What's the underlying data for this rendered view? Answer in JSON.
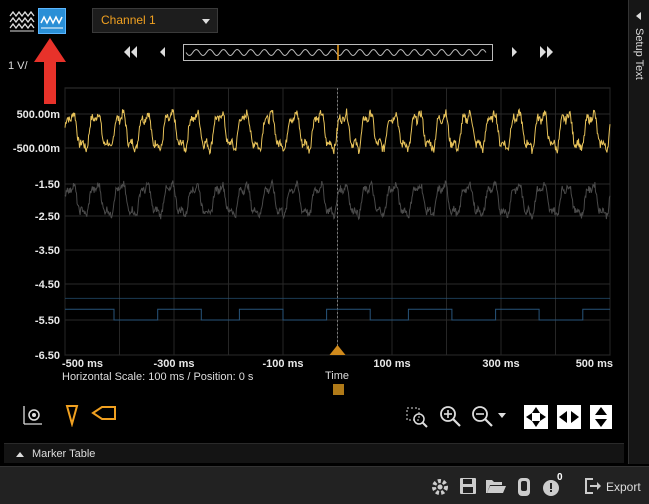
{
  "toolbar": {
    "overlay_icon": "waveform-overlay-icon",
    "single_icon": "waveform-single-icon",
    "channel_selected": "Channel 1"
  },
  "side_panel": {
    "label": "Setup Text"
  },
  "vertical_scale": "1 V/",
  "chart_data": {
    "type": "line",
    "y_ticks": [
      "500.00m",
      "-500.00m",
      "-1.50",
      "-2.50",
      "-3.50",
      "-4.50",
      "-5.50",
      "-6.50"
    ],
    "x_ticks": [
      "-500 ms",
      "-300 ms",
      "-100 ms",
      "100 ms",
      "300 ms",
      "500 ms"
    ],
    "xlim": [
      -500,
      500
    ],
    "xlabel": "Time",
    "grid": true,
    "series": [
      {
        "color": "#e8c35a",
        "shape": "noisy-sine",
        "center": 0.0,
        "amplitude": 0.5
      },
      {
        "color": "#4a4a4a",
        "shape": "noisy-sine",
        "center": -2.0,
        "amplitude": 0.45
      },
      {
        "color": "#27547a",
        "shape": "digital",
        "levels": [
          -5.2,
          -5.5
        ]
      }
    ]
  },
  "horizontal": {
    "scale_text": "Horizontal Scale: 100 ms /  Position: 0 s",
    "time_label": "Time"
  },
  "marker_table": {
    "label": "Marker Table"
  },
  "footer": {
    "export_label": "Export",
    "badge_count": "0"
  },
  "colors": {
    "accent": "#f0a020",
    "selected": "#2a8fd6",
    "annotation": "#e8322a"
  }
}
